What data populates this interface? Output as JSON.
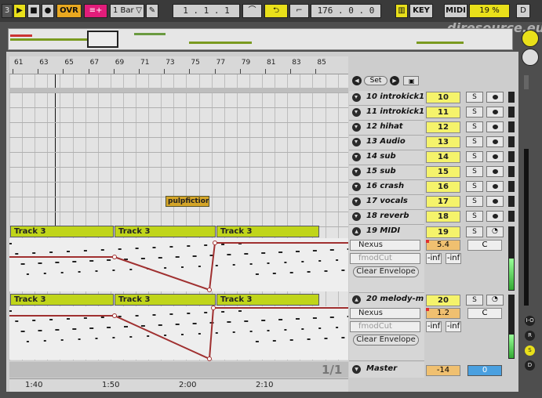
{
  "toolbar": {
    "num_label": "3",
    "ovr_label": "OVR",
    "quantize_label": "1 Bar",
    "position": "1 .  1 .  1",
    "loop_length": "176 .  0 .  0",
    "key_label": "KEY",
    "midi_label": "MIDI",
    "cpu": "19 %",
    "d_label": "D"
  },
  "watermark": "djresource.eu",
  "ruler": {
    "ticks": [
      "61",
      "63",
      "65",
      "67",
      "69",
      "71",
      "73",
      "75",
      "77",
      "79",
      "81",
      "83",
      "85"
    ]
  },
  "locators": {
    "set_label": "Set"
  },
  "tracks": [
    {
      "name": "10 introkick1",
      "number": "10"
    },
    {
      "name": "11 introkick1",
      "number": "11"
    },
    {
      "name": "12 hihat",
      "number": "12"
    },
    {
      "name": "13 Audio",
      "number": "13"
    },
    {
      "name": "14 sub",
      "number": "14"
    },
    {
      "name": "15 sub",
      "number": "15"
    },
    {
      "name": "16 crash",
      "number": "16"
    },
    {
      "name": "17 vocals",
      "number": "17"
    },
    {
      "name": "18 reverb",
      "number": "18"
    }
  ],
  "solo_label": "S",
  "midi_track": {
    "name": "19 MIDI",
    "number": "19",
    "device": "Nexus",
    "param": "fmodCut",
    "volume": "5.4",
    "pan": "C",
    "send_a": "-inf",
    "send_b": "-inf",
    "clear_label": "Clear Envelope",
    "clips": [
      "Track 3",
      "Track 3",
      "Track 3"
    ]
  },
  "melody_track": {
    "name": "20 melody-m",
    "number": "20",
    "device": "Nexus",
    "param": "fmodCut",
    "volume": "1.2",
    "pan": "C",
    "send_a": "-inf",
    "send_b": "-inf",
    "clear_label": "Clear Envelope",
    "clips": [
      "Track 3",
      "Track 3",
      "Track 3"
    ]
  },
  "audio_clip_label": "pulpfiction-",
  "master": {
    "name": "Master",
    "volume": "-14",
    "pan": "0",
    "page": "1/1"
  },
  "time_ruler": [
    "1:40",
    "1:50",
    "2:00",
    "2:10"
  ],
  "side_dots": [
    "I-O",
    "R",
    "S",
    "D"
  ],
  "colors": {
    "clip": "#c0d51a",
    "track_num": "#f5f36b",
    "envelope": "#a03030",
    "accent": "#f0ea1a"
  }
}
